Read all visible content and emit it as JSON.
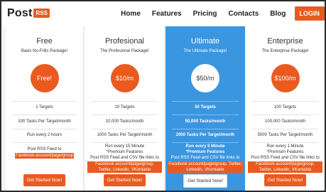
{
  "header": {
    "logo_text": "Post",
    "logo_badge": "RSS",
    "nav": [
      {
        "label": "Home"
      },
      {
        "label": "Features"
      },
      {
        "label": "Pricing"
      },
      {
        "label": "Contacts"
      },
      {
        "label": "Blog"
      }
    ],
    "login_label": "LOGIN"
  },
  "plans": [
    {
      "title": "Free",
      "subtitle": "Basic No-Frills Package!",
      "price": "Free!",
      "targets": "1 Targets",
      "tasks": "100 Tasks Per Target/month",
      "run": "Run every 2 hours",
      "feed_text": "Post RSS Feed to",
      "feed_highlight": "Facebook account/page/group",
      "cta": "Get Started Now!"
    },
    {
      "title": "Profesional",
      "subtitle": "The Profesional Package!",
      "price": "$10/m",
      "targets": "10 Targets",
      "tasks": "10,000 Tasks/month",
      "run": "1000 Tasks Per Target/month",
      "every": "Run every 15 Minute",
      "premium": "*Premium Features",
      "feed_text": "Post RSS Feed and CSV file links to",
      "feed_highlight": "Facebook account/page/group, Twitter, Linkedin, VKontakte",
      "cta": "Get Started Now!"
    },
    {
      "title": "Ultimate",
      "subtitle": "The Ultimate Package!",
      "price": "$50/m",
      "targets": "50 Targets",
      "tasks": "50,000 Tasks/month",
      "run": "2000 Tasks Per Target/month",
      "every": "Run every 5 Minute",
      "premium": "*Premium Features",
      "feed_text": "Post RSS Feed and CSV file links to",
      "feed_highlight": "Facebook account/page/group, Twitter, Linkedin, VKontakte",
      "cta": "Get Started Now!"
    },
    {
      "title": "Enterprise",
      "subtitle": "The Enterprise Package!",
      "price": "$100/m",
      "targets": "100 Targets",
      "tasks": "100,000 Tasks/month",
      "run": "5000 Tasks Per Target/month",
      "every": "Run every 1 Minute",
      "premium": "*Premium Features",
      "feed_text": "Post RSS Feed and CSV file links to",
      "feed_highlight": "Facebook account/page/group, Twitter, Linkedin, VKontakte",
      "cta": "Get Started Now!"
    }
  ],
  "colors": {
    "accent": "#ea5a1f",
    "highlight_column": "#3b96e0"
  }
}
